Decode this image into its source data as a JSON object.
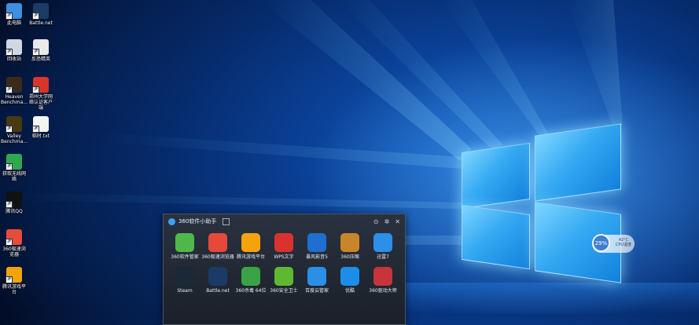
{
  "desktop": {
    "icons": [
      {
        "label": "此电脑",
        "icon": "computer-icon",
        "color": "#3d8fe0"
      },
      {
        "label": "Battle.net",
        "icon": "battlenet-icon",
        "color": "#1b3b66"
      },
      {
        "label": "回收站",
        "icon": "recycle-bin-icon",
        "color": "#cfd8e3"
      },
      {
        "label": "反恐精英",
        "icon": "counter-strike-icon",
        "color": "#e9e9e9"
      },
      {
        "label": "Heaven Benchma...",
        "icon": "heaven-benchmark-icon",
        "color": "#3a2a1a"
      },
      {
        "label": "郑州大学网络认证客户端",
        "icon": "campus-network-icon",
        "color": "#d9352b"
      },
      {
        "label": "Valley Benchma...",
        "icon": "valley-benchmark-icon",
        "color": "#4a3a12"
      },
      {
        "label": "临时.txt",
        "icon": "text-file-icon",
        "color": "#f4f4f4"
      },
      {
        "label": "获取无线网络",
        "icon": "wifi-tool-icon",
        "color": "#2fa84f"
      },
      {
        "label": "腾讯QQ",
        "icon": "qq-icon",
        "color": "#111111"
      },
      {
        "label": "360极速浏览器",
        "icon": "360-browser-icon",
        "color": "#e64b3b"
      },
      {
        "label": "腾讯游戏平台",
        "icon": "tencent-games-icon",
        "color": "#f2a20b"
      }
    ]
  },
  "helper": {
    "title": "360软件小助手",
    "apps": [
      {
        "label": "360软件管家",
        "icon": "360-software-manager-icon",
        "color": "#4fb84a"
      },
      {
        "label": "360极速浏览器",
        "icon": "360-browser-icon",
        "color": "#e5493a"
      },
      {
        "label": "腾讯游戏平台",
        "icon": "tencent-games-icon",
        "color": "#f5a30c"
      },
      {
        "label": "WPS文字",
        "icon": "wps-writer-icon",
        "color": "#d9322f"
      },
      {
        "label": "暴风影音5",
        "icon": "baofeng-player-icon",
        "color": "#1e6fd0"
      },
      {
        "label": "360压缩",
        "icon": "360-zip-icon",
        "color": "#c9852a"
      },
      {
        "label": "迅雷7",
        "icon": "xunlei-icon",
        "color": "#2c8fe8"
      },
      {
        "label": "Steam",
        "icon": "steam-icon",
        "color": "#1b2838"
      },
      {
        "label": "Battle.net",
        "icon": "battlenet-icon",
        "color": "#1b3b66"
      },
      {
        "label": "360杀毒 64位",
        "icon": "360-antivirus-icon",
        "color": "#3aa346"
      },
      {
        "label": "360安全卫士",
        "icon": "360-safeguard-icon",
        "color": "#5fb831"
      },
      {
        "label": "百度云管家",
        "icon": "baidu-cloud-icon",
        "color": "#2a8fe6"
      },
      {
        "label": "优酷",
        "icon": "youku-icon",
        "color": "#1d8ee8"
      },
      {
        "label": "360驱动大师",
        "icon": "360-driver-icon",
        "color": "#c7343b"
      }
    ]
  },
  "cpu_widget": {
    "value": "29%",
    "line1": "42°C",
    "line2": "CPU温度"
  }
}
